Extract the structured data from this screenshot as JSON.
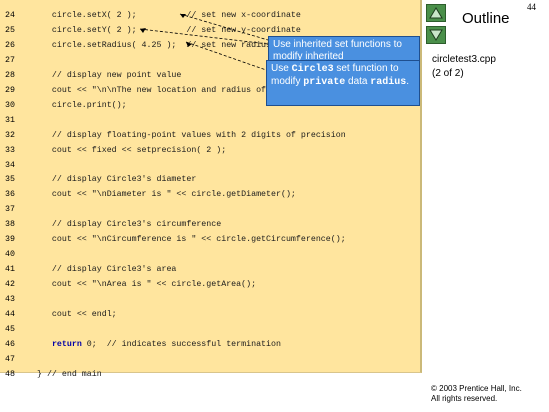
{
  "slide_number": "44",
  "outline": {
    "title": "Outline",
    "file_name": "circletest3.cpp",
    "page_info": "(2 of 2)",
    "nav_up_icon": "triangle-up-icon",
    "nav_down_icon": "triangle-down-icon"
  },
  "code_lines": [
    {
      "num": "24",
      "pre": "   circle.setX( 2 );          // set new x-coordinate",
      "kw": "",
      "post": ""
    },
    {
      "num": "25",
      "pre": "   circle.setY( 2 );          // set new y-coordinate",
      "kw": "",
      "post": ""
    },
    {
      "num": "26",
      "pre": "   circle.setRadius( 4.25 );  // set new radius",
      "kw": "",
      "post": ""
    },
    {
      "num": "27",
      "pre": "",
      "kw": "",
      "post": ""
    },
    {
      "num": "28",
      "pre": "   // display new point value",
      "kw": "",
      "post": ""
    },
    {
      "num": "29",
      "pre": "   cout << \"\\n\\nThe new location and radius of circle are\\n\";",
      "kw": "",
      "post": ""
    },
    {
      "num": "30",
      "pre": "   circle.print();",
      "kw": "",
      "post": ""
    },
    {
      "num": "31",
      "pre": "",
      "kw": "",
      "post": ""
    },
    {
      "num": "32",
      "pre": "   // display floating-point values with 2 digits of precision",
      "kw": "",
      "post": ""
    },
    {
      "num": "33",
      "pre": "   cout << fixed << setprecision( 2 );",
      "kw": "",
      "post": ""
    },
    {
      "num": "34",
      "pre": "",
      "kw": "",
      "post": ""
    },
    {
      "num": "35",
      "pre": "   // display Circle3's diameter",
      "kw": "",
      "post": ""
    },
    {
      "num": "36",
      "pre": "   cout << \"\\nDiameter is \" << circle.getDiameter();",
      "kw": "",
      "post": ""
    },
    {
      "num": "37",
      "pre": "",
      "kw": "",
      "post": ""
    },
    {
      "num": "38",
      "pre": "   // display Circle3's circumference",
      "kw": "",
      "post": ""
    },
    {
      "num": "39",
      "pre": "   cout << \"\\nCircumference is \" << circle.getCircumference();",
      "kw": "",
      "post": ""
    },
    {
      "num": "40",
      "pre": "",
      "kw": "",
      "post": ""
    },
    {
      "num": "41",
      "pre": "   // display Circle3's area",
      "kw": "",
      "post": ""
    },
    {
      "num": "42",
      "pre": "   cout << \"\\nArea is \" << circle.getArea();",
      "kw": "",
      "post": ""
    },
    {
      "num": "43",
      "pre": "",
      "kw": "",
      "post": ""
    },
    {
      "num": "44",
      "pre": "   cout << endl;",
      "kw": "",
      "post": ""
    },
    {
      "num": "45",
      "pre": "",
      "kw": "",
      "post": ""
    },
    {
      "num": "46",
      "pre": "   ",
      "kw": "return",
      "post": " 0;  // indicates successful termination"
    },
    {
      "num": "47",
      "pre": "",
      "kw": "",
      "post": ""
    },
    {
      "num": "48",
      "pre": "} // end main",
      "kw": "",
      "post": ""
    }
  ],
  "callouts": {
    "inherited": "Use inherited set functions to modify inherited",
    "circle3_part1": "Use ",
    "circle3_code": "Circle3",
    "circle3_part2": " set function to modify ",
    "circle3_code2": "private",
    "circle3_part3": " data ",
    "circle3_code3": "radius",
    "circle3_part4": "."
  },
  "copyright": {
    "line1": "© 2003 Prentice Hall, Inc.",
    "line2": "All rights reserved."
  }
}
